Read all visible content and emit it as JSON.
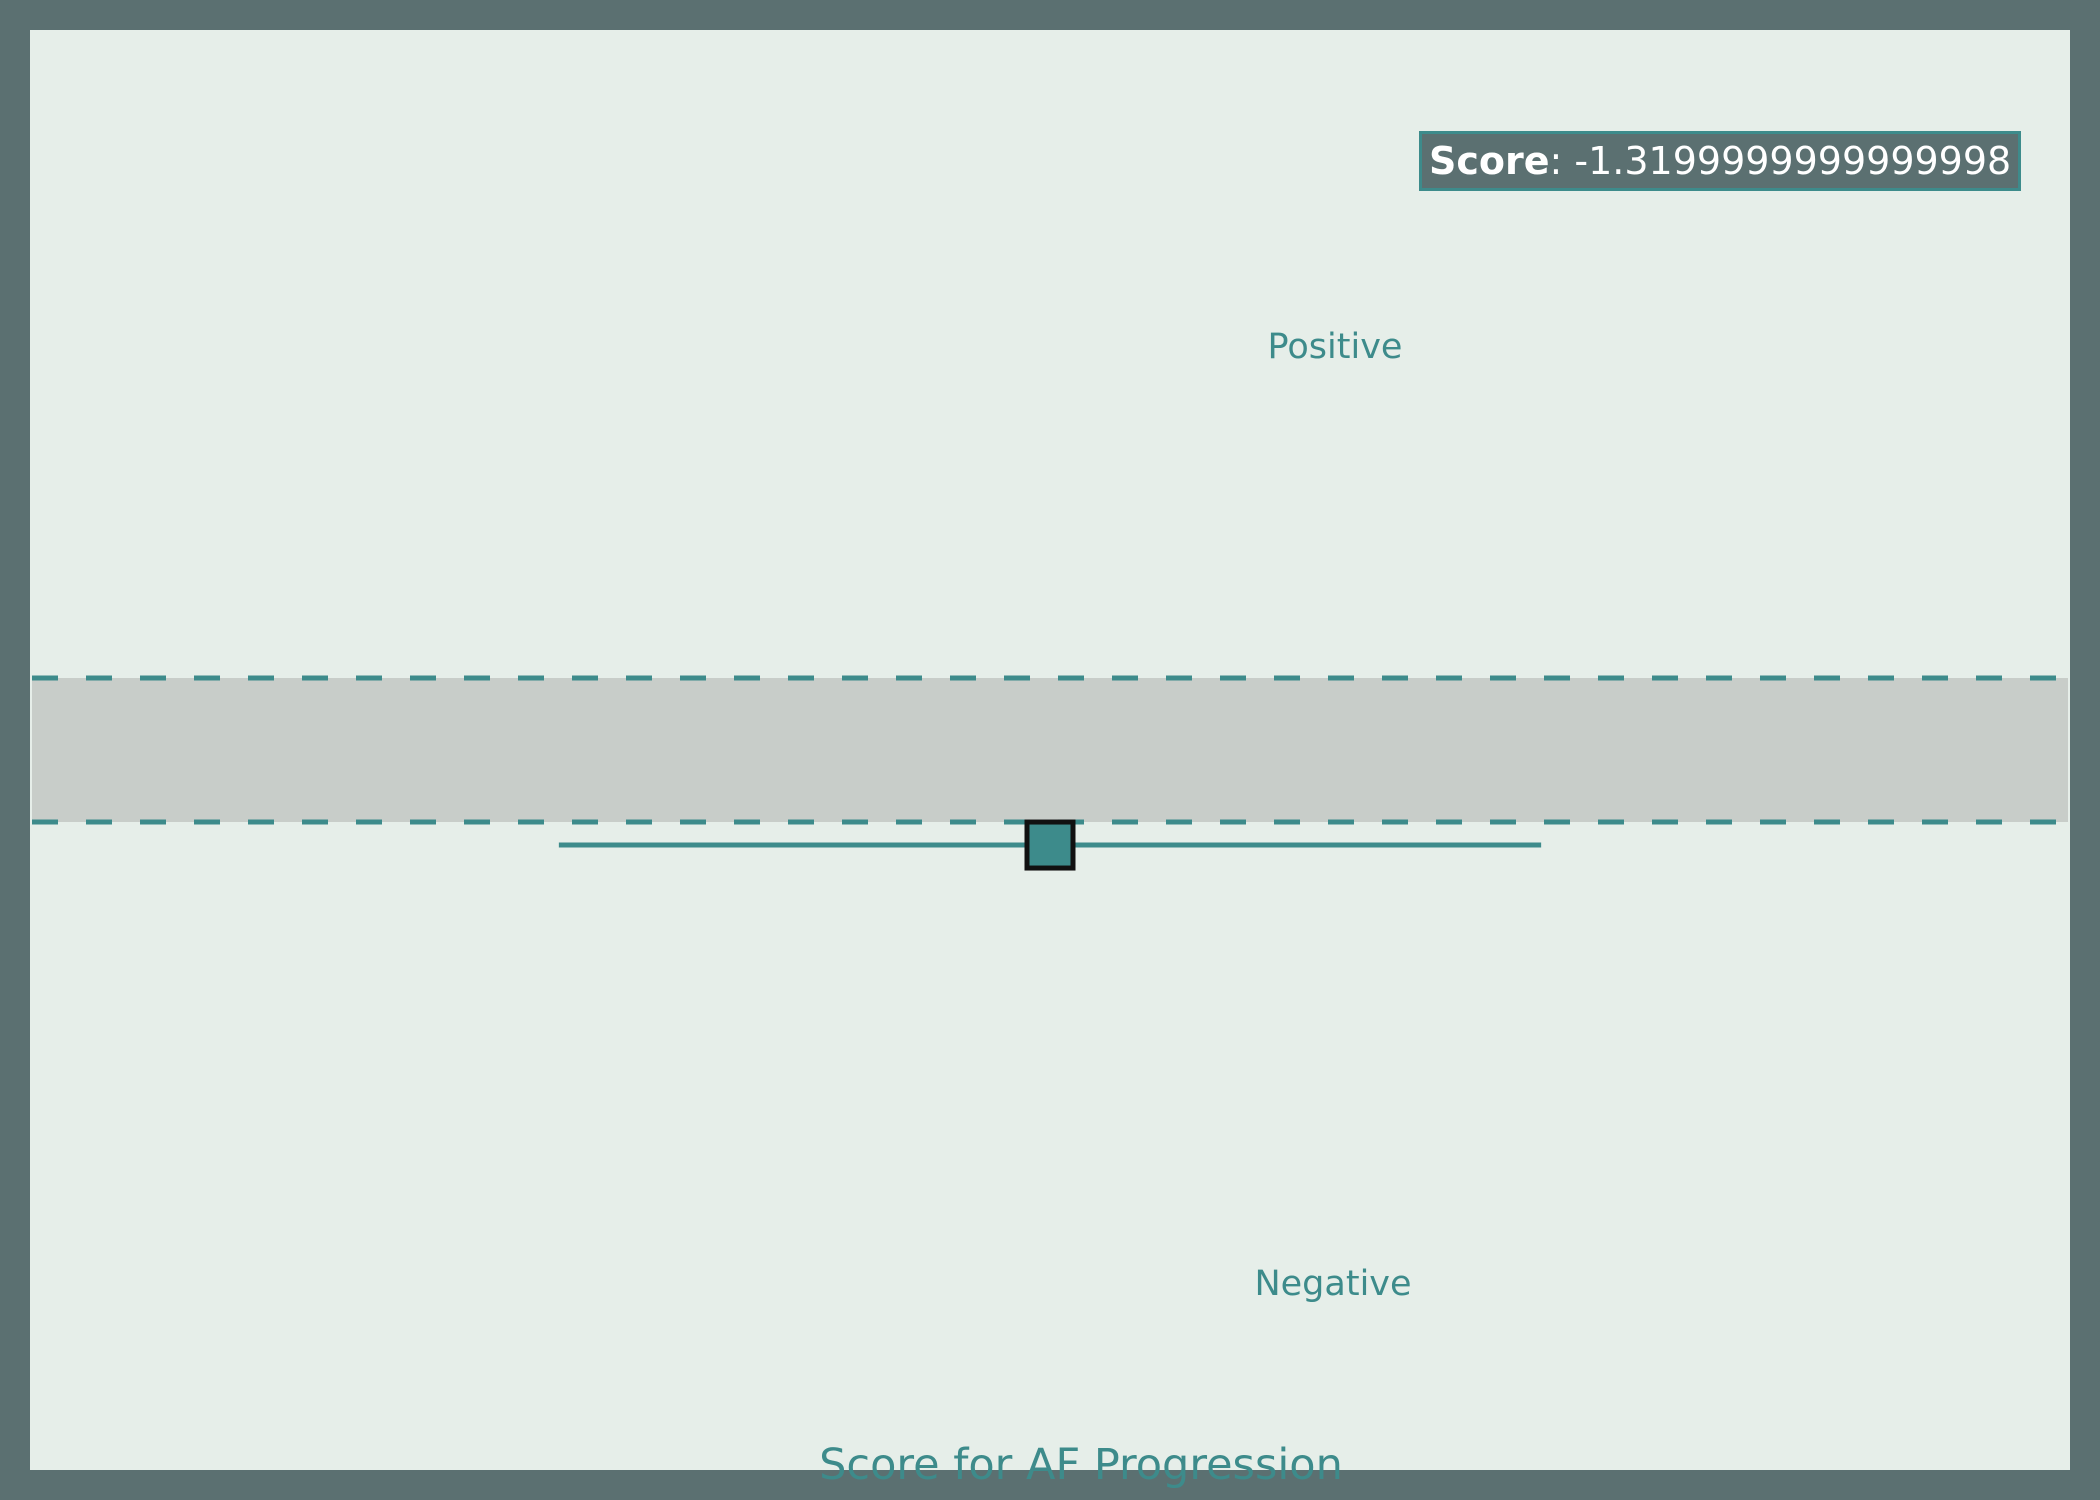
{
  "chart_data": {
    "type": "scatter",
    "title": "Score for AF Progression",
    "score_label": "Score",
    "score_value": "-1.3199999999999998",
    "region_labels": {
      "positive": "Positive",
      "negative": "Negative"
    },
    "point": {
      "x": 0,
      "y": -1.32,
      "x_error": [
        -11,
        11
      ]
    },
    "neutral_band": [
      -1.0,
      1.0
    ],
    "xlim": [
      -22.8,
      22.8
    ],
    "ylim": [
      -10,
      10
    ],
    "colors": {
      "background": "#e6eee9",
      "frame": "#5b7071",
      "accent": "#3d8b8b",
      "band": "#c8cdc9",
      "marker_edge": "#111111"
    }
  }
}
